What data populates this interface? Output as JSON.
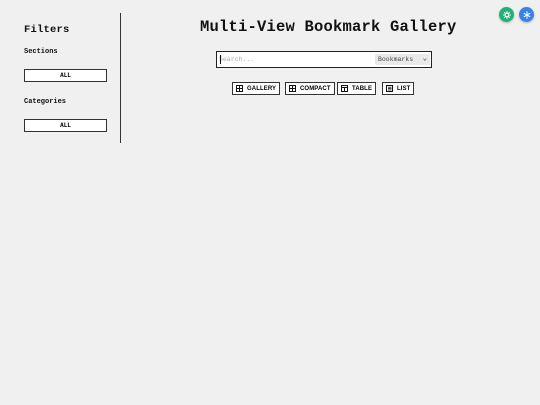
{
  "sidebar": {
    "title": "Filters",
    "sections_label": "Sections",
    "sections_button": "ALL",
    "categories_label": "Categories",
    "categories_button": "ALL"
  },
  "main": {
    "title": "Multi-View Bookmark Gallery"
  },
  "search": {
    "placeholder": "Search...",
    "value": "",
    "select_value": "Bookmarks"
  },
  "views": [
    {
      "label": "GALLERY",
      "icon": "grid-icon"
    },
    {
      "label": "COMPACT",
      "icon": "grid-icon"
    },
    {
      "label": "TABLE",
      "icon": "table-icon"
    },
    {
      "label": "LIST",
      "icon": "list-icon"
    }
  ],
  "floating_buttons": [
    {
      "icon": "gear-icon",
      "color": "#22b07a"
    },
    {
      "icon": "snowflake-icon",
      "color": "#3b82e6"
    }
  ],
  "colors": {
    "background": "#f0f0f0",
    "border": "#333333",
    "accent_green": "#22b07a",
    "accent_blue": "#3b82e6"
  }
}
